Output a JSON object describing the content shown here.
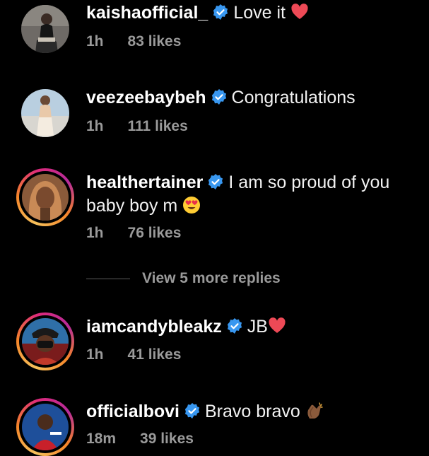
{
  "comments": [
    {
      "username": "kaishaofficial_",
      "text": "Love it",
      "emoji": "red-heart",
      "time": "1h",
      "likes": "83 likes",
      "avatar_ring": false
    },
    {
      "username": "veezeebaybeh",
      "text": "Congratulations",
      "time": "1h",
      "likes": "111 likes",
      "avatar_ring": false
    },
    {
      "username": "healthertainer",
      "text": "I am so proud of you baby boy m",
      "emoji": "heart-eyes",
      "time": "1h",
      "likes": "76 likes",
      "avatar_ring": true
    },
    {
      "username": "iamcandybleakz",
      "text": "JB",
      "emoji": "red-heart",
      "time": "1h",
      "likes": "41 likes",
      "avatar_ring": true
    },
    {
      "username": "officialbovi",
      "text": "Bravo bravo",
      "emoji": "clapping-hands",
      "time": "18m",
      "likes": "39 likes",
      "avatar_ring": true
    }
  ],
  "view_more_replies": "View 5 more replies",
  "colors": {
    "background": "#000000",
    "text": "#f2f2f2",
    "muted": "#9a9a9a",
    "verified": "#3897f0",
    "heart": "#ed4956"
  }
}
